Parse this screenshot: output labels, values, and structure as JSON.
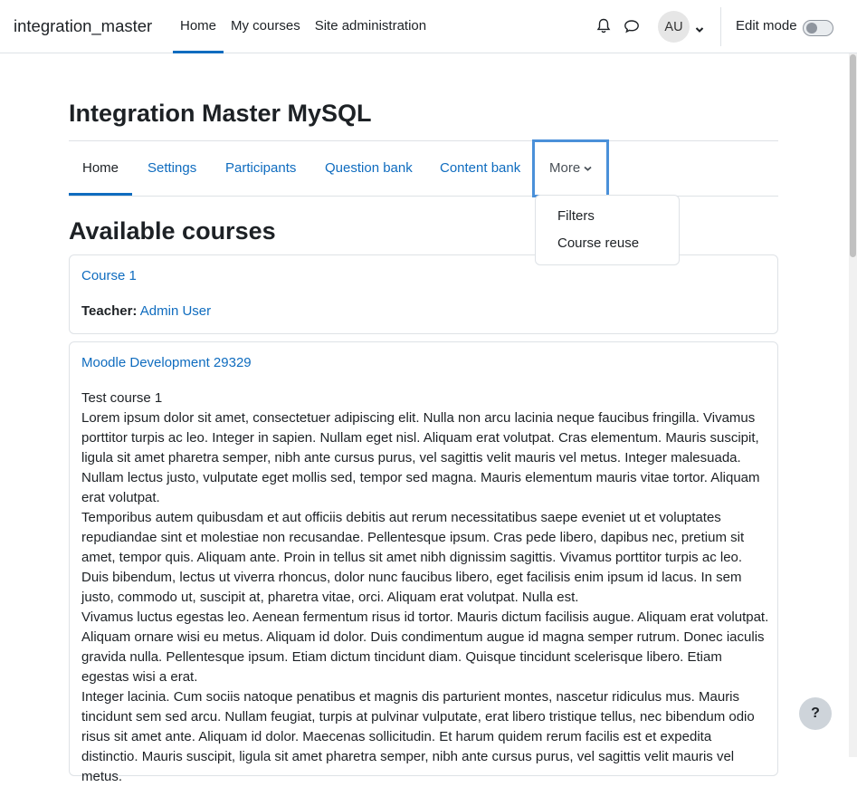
{
  "navbar": {
    "brand": "integration_master",
    "items": [
      {
        "label": "Home",
        "active": true
      },
      {
        "label": "My courses",
        "active": false
      },
      {
        "label": "Site administration",
        "active": false
      }
    ],
    "avatar_initials": "AU",
    "edit_mode_label": "Edit mode",
    "edit_mode_on": false
  },
  "page": {
    "title": "Integration Master MySQL"
  },
  "secondary_nav": {
    "items": [
      {
        "label": "Home",
        "active": true
      },
      {
        "label": "Settings",
        "active": false
      },
      {
        "label": "Participants",
        "active": false
      },
      {
        "label": "Question bank",
        "active": false
      },
      {
        "label": "Content bank",
        "active": false
      }
    ],
    "more_label": "More",
    "more_menu": [
      "Filters",
      "Course reuse"
    ]
  },
  "available_courses": {
    "heading": "Available courses",
    "courses": [
      {
        "name": "Course 1",
        "teacher_label": "Teacher:",
        "teacher_name": "Admin User"
      },
      {
        "name": "Moodle Development 29329",
        "summary": [
          "Test course 1",
          "Lorem ipsum dolor sit amet, consectetuer adipiscing elit. Nulla non arcu lacinia neque faucibus fringilla. Vivamus porttitor turpis ac leo. Integer in sapien. Nullam eget nisl. Aliquam erat volutpat. Cras elementum. Mauris suscipit, ligula sit amet pharetra semper, nibh ante cursus purus, vel sagittis velit mauris vel metus. Integer malesuada. Nullam lectus justo, vulputate eget mollis sed, tempor sed magna. Mauris elementum mauris vitae tortor. Aliquam erat volutpat.",
          "Temporibus autem quibusdam et aut officiis debitis aut rerum necessitatibus saepe eveniet ut et voluptates repudiandae sint et molestiae non recusandae. Pellentesque ipsum. Cras pede libero, dapibus nec, pretium sit amet, tempor quis. Aliquam ante. Proin in tellus sit amet nibh dignissim sagittis. Vivamus porttitor turpis ac leo. Duis bibendum, lectus ut viverra rhoncus, dolor nunc faucibus libero, eget facilisis enim ipsum id lacus. In sem justo, commodo ut, suscipit at, pharetra vitae, orci. Aliquam erat volutpat. Nulla est.",
          "Vivamus luctus egestas leo. Aenean fermentum risus id tortor. Mauris dictum facilisis augue. Aliquam erat volutpat. Aliquam ornare wisi eu metus. Aliquam id dolor. Duis condimentum augue id magna semper rutrum. Donec iaculis gravida nulla. Pellentesque ipsum. Etiam dictum tincidunt diam. Quisque tincidunt scelerisque libero. Etiam egestas wisi a erat.",
          "Integer lacinia. Cum sociis natoque penatibus et magnis dis parturient montes, nascetur ridiculus mus. Mauris tincidunt sem sed arcu. Nullam feugiat, turpis at pulvinar vulputate, erat libero tristique tellus, nec bibendum odio risus sit amet ante. Aliquam id dolor. Maecenas sollicitudin. Et harum quidem rerum facilis est et expedita distinctio. Mauris suscipit, ligula sit amet pharetra semper, nibh ante cursus purus, vel sagittis velit mauris vel metus."
        ]
      }
    ]
  },
  "help_button_label": "?",
  "icons": {
    "notifications": "bell-icon",
    "messages": "chat-bubble-icon",
    "user_menu": "chevron-down-icon",
    "more": "chevron-down-icon"
  },
  "colors": {
    "link": "#0f6cbf",
    "active_underline": "#0f6cbf",
    "focus_outline": "#4a90d9"
  }
}
